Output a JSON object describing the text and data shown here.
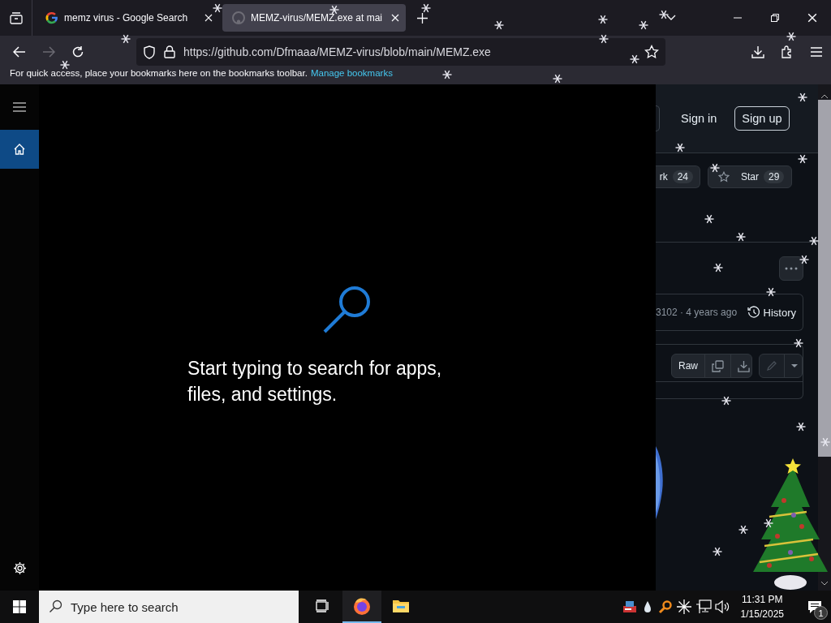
{
  "browser": {
    "tabs": [
      {
        "title": "memz virus - Google Search",
        "selected": false
      },
      {
        "title": "MEMZ-virus/MEMZ.exe at mai",
        "selected": true
      }
    ],
    "address": "https://github.com/Dfmaaa/MEMZ-virus/blob/main/MEMZ.exe",
    "bookmarks_bar": {
      "hint": "For quick access, place your bookmarks here on the bookmarks toolbar.",
      "link": "Manage bookmarks"
    }
  },
  "page": {
    "header_buttons": [
      "Sign in",
      "Sign up"
    ],
    "fork": {
      "label": "rk",
      "count": "24"
    },
    "star": {
      "label": "Star",
      "count": "29"
    },
    "commit": "3102 · 4 years ago",
    "history": "History",
    "raw": "Raw"
  },
  "start_search": {
    "nav": [
      {
        "kind": "home",
        "selected": true
      }
    ],
    "message": "Start typing to search for apps, files, and settings."
  },
  "taskbar": {
    "search": {
      "placeholder": "Type here to search"
    },
    "apps": [
      {
        "kind": "task-view",
        "active": false
      },
      {
        "kind": "firefox",
        "active": true
      },
      {
        "kind": "explorer",
        "active": false
      }
    ],
    "time": "11:31 PM",
    "date": "1/15/2025",
    "notifications": "1"
  }
}
